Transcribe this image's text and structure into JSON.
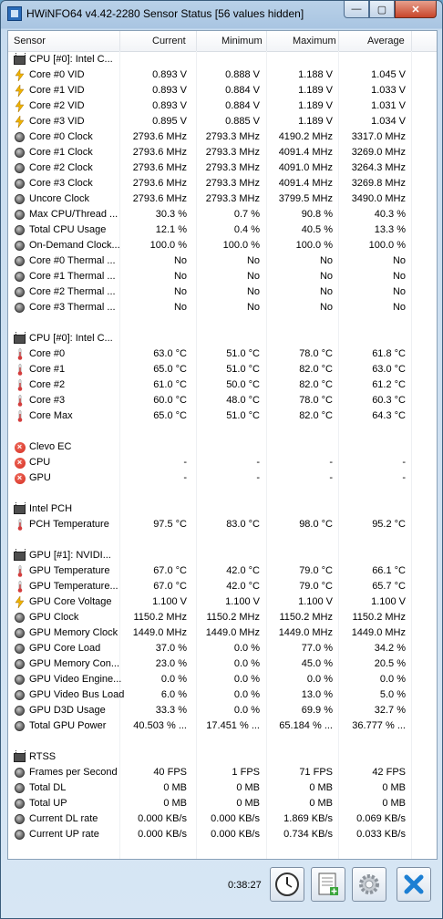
{
  "window": {
    "title": "HWiNFO64 v4.42-2280 Sensor Status [56 values hidden]"
  },
  "title_buttons": {
    "minimize": "—",
    "maximize": "▢",
    "close": "✕"
  },
  "columns": [
    "Sensor",
    "Current",
    "Minimum",
    "Maximum",
    "Average"
  ],
  "rows": [
    {
      "type": "group",
      "icon": "cpu",
      "label": "CPU [#0]: Intel C..."
    },
    {
      "type": "data",
      "icon": "voltage",
      "label": "Core #0 VID",
      "current": "0.893 V",
      "minimum": "0.888 V",
      "maximum": "1.188 V",
      "average": "1.045 V"
    },
    {
      "type": "data",
      "icon": "voltage",
      "label": "Core #1 VID",
      "current": "0.893 V",
      "minimum": "0.884 V",
      "maximum": "1.189 V",
      "average": "1.033 V"
    },
    {
      "type": "data",
      "icon": "voltage",
      "label": "Core #2 VID",
      "current": "0.893 V",
      "minimum": "0.884 V",
      "maximum": "1.189 V",
      "average": "1.031 V"
    },
    {
      "type": "data",
      "icon": "voltage",
      "label": "Core #3 VID",
      "current": "0.895 V",
      "minimum": "0.885 V",
      "maximum": "1.189 V",
      "average": "1.034 V"
    },
    {
      "type": "data",
      "icon": "dial",
      "label": "Core #0 Clock",
      "current": "2793.6 MHz",
      "minimum": "2793.3 MHz",
      "maximum": "4190.2 MHz",
      "average": "3317.0 MHz"
    },
    {
      "type": "data",
      "icon": "dial",
      "label": "Core #1 Clock",
      "current": "2793.6 MHz",
      "minimum": "2793.3 MHz",
      "maximum": "4091.4 MHz",
      "average": "3269.0 MHz"
    },
    {
      "type": "data",
      "icon": "dial",
      "label": "Core #2 Clock",
      "current": "2793.6 MHz",
      "minimum": "2793.3 MHz",
      "maximum": "4091.0 MHz",
      "average": "3264.3 MHz"
    },
    {
      "type": "data",
      "icon": "dial",
      "label": "Core #3 Clock",
      "current": "2793.6 MHz",
      "minimum": "2793.3 MHz",
      "maximum": "4091.4 MHz",
      "average": "3269.8 MHz"
    },
    {
      "type": "data",
      "icon": "dial",
      "label": "Uncore Clock",
      "current": "2793.6 MHz",
      "minimum": "2793.3 MHz",
      "maximum": "3799.5 MHz",
      "average": "3490.0 MHz"
    },
    {
      "type": "data",
      "icon": "dial",
      "label": "Max CPU/Thread ...",
      "current": "30.3 %",
      "minimum": "0.7 %",
      "maximum": "90.8 %",
      "average": "40.3 %"
    },
    {
      "type": "data",
      "icon": "dial",
      "label": "Total CPU Usage",
      "current": "12.1 %",
      "minimum": "0.4 %",
      "maximum": "40.5 %",
      "average": "13.3 %"
    },
    {
      "type": "data",
      "icon": "dial",
      "label": "On-Demand Clock...",
      "current": "100.0 %",
      "minimum": "100.0 %",
      "maximum": "100.0 %",
      "average": "100.0 %"
    },
    {
      "type": "data",
      "icon": "dial",
      "label": "Core #0 Thermal ...",
      "current": "No",
      "minimum": "No",
      "maximum": "No",
      "average": "No"
    },
    {
      "type": "data",
      "icon": "dial",
      "label": "Core #1 Thermal ...",
      "current": "No",
      "minimum": "No",
      "maximum": "No",
      "average": "No"
    },
    {
      "type": "data",
      "icon": "dial",
      "label": "Core #2 Thermal ...",
      "current": "No",
      "minimum": "No",
      "maximum": "No",
      "average": "No"
    },
    {
      "type": "data",
      "icon": "dial",
      "label": "Core #3 Thermal ...",
      "current": "No",
      "minimum": "No",
      "maximum": "No",
      "average": "No"
    },
    {
      "type": "blank"
    },
    {
      "type": "group",
      "icon": "cpu",
      "label": "CPU [#0]: Intel C..."
    },
    {
      "type": "data",
      "icon": "thermometer",
      "label": "Core #0",
      "current": "63.0 °C",
      "minimum": "51.0 °C",
      "maximum": "78.0 °C",
      "average": "61.8 °C"
    },
    {
      "type": "data",
      "icon": "thermometer",
      "label": "Core #1",
      "current": "65.0 °C",
      "minimum": "51.0 °C",
      "maximum": "82.0 °C",
      "average": "63.0 °C"
    },
    {
      "type": "data",
      "icon": "thermometer",
      "label": "Core #2",
      "current": "61.0 °C",
      "minimum": "50.0 °C",
      "maximum": "82.0 °C",
      "average": "61.2 °C"
    },
    {
      "type": "data",
      "icon": "thermometer",
      "label": "Core #3",
      "current": "60.0 °C",
      "minimum": "48.0 °C",
      "maximum": "78.0 °C",
      "average": "60.3 °C"
    },
    {
      "type": "data",
      "icon": "thermometer",
      "label": "Core Max",
      "current": "65.0 °C",
      "minimum": "51.0 °C",
      "maximum": "82.0 °C",
      "average": "64.3 °C"
    },
    {
      "type": "blank"
    },
    {
      "type": "group",
      "icon": "error",
      "label": "Clevo EC"
    },
    {
      "type": "data",
      "icon": "error",
      "label": "CPU",
      "current": "-",
      "minimum": "-",
      "maximum": "-",
      "average": "-"
    },
    {
      "type": "data",
      "icon": "error",
      "label": "GPU",
      "current": "-",
      "minimum": "-",
      "maximum": "-",
      "average": "-"
    },
    {
      "type": "blank"
    },
    {
      "type": "group",
      "icon": "cpu",
      "label": "Intel PCH"
    },
    {
      "type": "data",
      "icon": "thermometer",
      "label": "PCH Temperature",
      "current": "97.5 °C",
      "minimum": "83.0 °C",
      "maximum": "98.0 °C",
      "average": "95.2 °C"
    },
    {
      "type": "blank"
    },
    {
      "type": "group",
      "icon": "cpu",
      "label": "GPU [#1]: NVIDI..."
    },
    {
      "type": "data",
      "icon": "thermometer",
      "label": "GPU Temperature",
      "current": "67.0 °C",
      "minimum": "42.0 °C",
      "maximum": "79.0 °C",
      "average": "66.1 °C"
    },
    {
      "type": "data",
      "icon": "thermometer",
      "label": "GPU Temperature...",
      "current": "67.0 °C",
      "minimum": "42.0 °C",
      "maximum": "79.0 °C",
      "average": "65.7 °C"
    },
    {
      "type": "data",
      "icon": "voltage",
      "label": "GPU Core Voltage",
      "current": "1.100 V",
      "minimum": "1.100 V",
      "maximum": "1.100 V",
      "average": "1.100 V"
    },
    {
      "type": "data",
      "icon": "dial",
      "label": "GPU Clock",
      "current": "1150.2 MHz",
      "minimum": "1150.2 MHz",
      "maximum": "1150.2 MHz",
      "average": "1150.2 MHz"
    },
    {
      "type": "data",
      "icon": "dial",
      "label": "GPU Memory Clock",
      "current": "1449.0 MHz",
      "minimum": "1449.0 MHz",
      "maximum": "1449.0 MHz",
      "average": "1449.0 MHz"
    },
    {
      "type": "data",
      "icon": "dial",
      "label": "GPU Core Load",
      "current": "37.0 %",
      "minimum": "0.0 %",
      "maximum": "77.0 %",
      "average": "34.2 %"
    },
    {
      "type": "data",
      "icon": "dial",
      "label": "GPU Memory Con...",
      "current": "23.0 %",
      "minimum": "0.0 %",
      "maximum": "45.0 %",
      "average": "20.5 %"
    },
    {
      "type": "data",
      "icon": "dial",
      "label": "GPU Video Engine...",
      "current": "0.0 %",
      "minimum": "0.0 %",
      "maximum": "0.0 %",
      "average": "0.0 %"
    },
    {
      "type": "data",
      "icon": "dial",
      "label": "GPU Video Bus Load",
      "current": "6.0 %",
      "minimum": "0.0 %",
      "maximum": "13.0 %",
      "average": "5.0 %"
    },
    {
      "type": "data",
      "icon": "dial",
      "label": "GPU D3D Usage",
      "current": "33.3 %",
      "minimum": "0.0 %",
      "maximum": "69.9 %",
      "average": "32.7 %"
    },
    {
      "type": "data",
      "icon": "dial",
      "label": "Total GPU Power",
      "current": "40.503 % ...",
      "minimum": "17.451 % ...",
      "maximum": "65.184 % ...",
      "average": "36.777 % ..."
    },
    {
      "type": "blank"
    },
    {
      "type": "group",
      "icon": "cpu",
      "label": "RTSS"
    },
    {
      "type": "data",
      "icon": "dial",
      "label": "Frames per Second",
      "current": "40 FPS",
      "minimum": "1 FPS",
      "maximum": "71 FPS",
      "average": "42 FPS"
    },
    {
      "type": "data",
      "icon": "dial",
      "label": "Total DL",
      "current": "0 MB",
      "minimum": "0 MB",
      "maximum": "0 MB",
      "average": "0 MB"
    },
    {
      "type": "data",
      "icon": "dial",
      "label": "Total UP",
      "current": "0 MB",
      "minimum": "0 MB",
      "maximum": "0 MB",
      "average": "0 MB"
    },
    {
      "type": "data",
      "icon": "dial",
      "label": "Current DL rate",
      "current": "0.000 KB/s",
      "minimum": "0.000 KB/s",
      "maximum": "1.869 KB/s",
      "average": "0.069 KB/s"
    },
    {
      "type": "data",
      "icon": "dial",
      "label": "Current UP rate",
      "current": "0.000 KB/s",
      "minimum": "0.000 KB/s",
      "maximum": "0.734 KB/s",
      "average": "0.033 KB/s"
    }
  ],
  "footer": {
    "elapsed_time": "0:38:27",
    "buttons": [
      {
        "name": "clock-button",
        "icon": "clock-icon"
      },
      {
        "name": "log-button",
        "icon": "log-file-icon"
      },
      {
        "name": "settings-button",
        "icon": "gear-icon"
      },
      {
        "name": "close-sensors-button",
        "icon": "close-icon"
      }
    ]
  },
  "colors": {
    "voltage": "#f0b400",
    "thermometer": "#d43c3c",
    "error": "#d32a1e",
    "close_x": "#1d7fd3"
  }
}
